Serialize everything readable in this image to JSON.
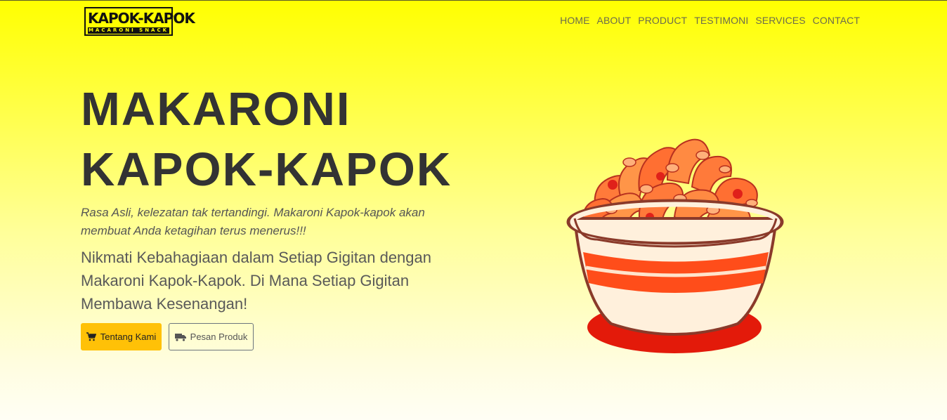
{
  "brand": {
    "logo_text": "KAPOK-KAPOK",
    "logo_subtext": "MACARONI SNACK",
    "accent": "#ffff00"
  },
  "nav": {
    "items": [
      {
        "label": "HOME"
      },
      {
        "label": "ABOUT"
      },
      {
        "label": "PRODUCT"
      },
      {
        "label": "TESTIMONI"
      },
      {
        "label": "SERVICES"
      },
      {
        "label": "CONTACT"
      }
    ]
  },
  "hero": {
    "title_line1": "MAKARONI",
    "title_line2": "KAPOK-KAPOK",
    "subtitle": "Rasa Asli, kelezatan tak tertandingi. Makaroni Kapok-kapok akan membuat Anda ketagihan terus menerus!!!",
    "lead": "Nikmati Kebahagiaan dalam Setiap Gigitan dengan Makaroni Kapok-Kapok. Di Mana Setiap Gigitan Membawa Kesenangan!",
    "primary_button": {
      "label": "Tentang Kami",
      "icon": "cart-icon",
      "color": "#ffc107"
    },
    "secondary_button": {
      "label": "Pesan Produk",
      "icon": "truck-icon"
    },
    "image_icon": "macaroni-bowl-illustration"
  }
}
